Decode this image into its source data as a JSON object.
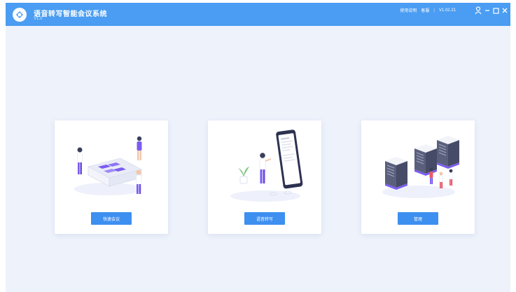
{
  "app": {
    "title": "语音转写智能会议系统",
    "version": "V1.0"
  },
  "topbar": {
    "links": [
      "使用说明",
      "客服",
      "V1.02.21"
    ],
    "icons": [
      "user-icon",
      "minimize-icon",
      "maximize-icon",
      "close-icon"
    ]
  },
  "cards": [
    {
      "button_label": "快速会议",
      "illustration": "meeting-illustration"
    },
    {
      "button_label": "语音转写",
      "illustration": "transcription-illustration"
    },
    {
      "button_label": "管理",
      "illustration": "server-illustration"
    }
  ],
  "colors": {
    "titlebar": "#4a9df2",
    "background": "#eef2fb",
    "button": "#3d8ff0",
    "accent_purple": "#7b5cf0"
  }
}
